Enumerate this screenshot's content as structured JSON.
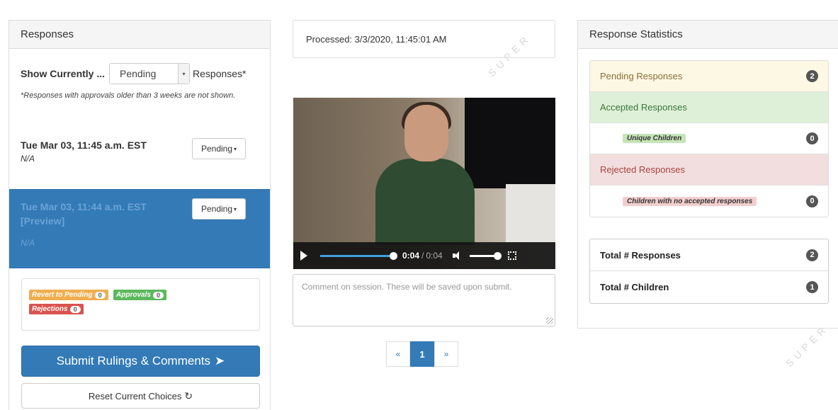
{
  "left": {
    "title": "Responses",
    "filter": {
      "label": "Show Currently ...",
      "selected": "Pending",
      "suffix": "Responses*",
      "note": "*Responses with approvals older than 3 weeks are not shown."
    },
    "responses": [
      {
        "date": "Tue Mar 03, 11:45 a.m. EST",
        "note": "N/A",
        "status": "Pending"
      },
      {
        "date": "Tue Mar 03, 11:44 a.m. EST [Preview]",
        "note": "N/A",
        "status": "Pending"
      }
    ],
    "summary": {
      "revert_label": "Revert to Pending",
      "revert_count": "0",
      "approvals_label": "Approvals",
      "approvals_count": "0",
      "rejections_label": "Rejections",
      "rejections_count": "0"
    },
    "submit_label": "Submit Rulings & Comments",
    "reset_label": "Reset Current Choices"
  },
  "middle": {
    "processed": "Processed: 3/3/2020, 11:45:01 AM",
    "video": {
      "time_current": "0:04",
      "separator": "/",
      "time_duration": "0:04",
      "progress_fraction": 1.0,
      "volume_fraction": 1.0
    },
    "comment_placeholder": "Comment on session. These will be saved upon submit.",
    "pager": {
      "prev": "«",
      "page": "1",
      "next": "»"
    }
  },
  "right": {
    "title": "Response Statistics",
    "stats": [
      {
        "label": "Pending Responses",
        "count": "2"
      },
      {
        "label": "Accepted Responses"
      },
      {
        "label": "Unique Children",
        "count": "0"
      },
      {
        "label": "Rejected Responses"
      },
      {
        "label": "Children with no accepted responses",
        "count": "0"
      }
    ],
    "totals": [
      {
        "label": "Total # Responses",
        "count": "2"
      },
      {
        "label": "Total # Children",
        "count": "1"
      }
    ]
  },
  "watermark_text": "SUPER",
  "colors": {
    "primary": "#337ab7",
    "warning": "#f0ad4e",
    "success": "#5cb85c",
    "danger": "#d9534f"
  }
}
